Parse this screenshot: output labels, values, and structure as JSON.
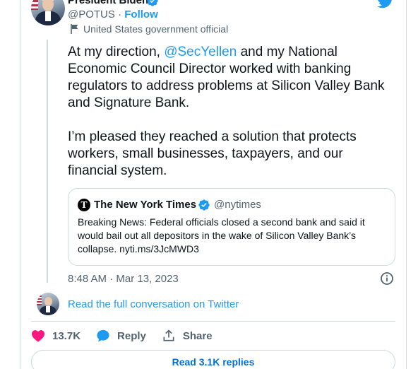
{
  "author": {
    "name": "President Biden",
    "handle": "@POTUS",
    "separator": " · ",
    "follow_label": "Follow",
    "gov_label": "United States government official"
  },
  "tweet": {
    "line1_prefix": "At my direction, ",
    "mention": "@SecYellen",
    "line1_suffix": " and my National Economic Council Director worked with banking regulators to address problems at Silicon Valley Bank and Signature Bank.",
    "paragraph2": "I’m pleased they reached a solution that protects workers, small businesses, taxpayers, and our financial system."
  },
  "quote": {
    "name": "The New York Times",
    "handle": "@nytimes",
    "logo_glyph": "T",
    "text": "Breaking News: Federal officials closed a second bank and said it would bail out all depositors in the wake of Silicon Valley Bank’s collapse. nyti.ms/3JcMWD3"
  },
  "meta": {
    "timestamp": "8:48 AM · Mar 13, 2023"
  },
  "conversation_link": "Read the full conversation on Twitter",
  "actions": {
    "like_count": "13.7K",
    "reply_label": "Reply",
    "share_label": "Share"
  },
  "read_replies_label": "Read 3.1K replies",
  "icons": {
    "verified": "verified-badge-icon",
    "twitter": "twitter-bird-icon",
    "flag": "government-flag-icon",
    "info": "info-icon",
    "heart": "heart-icon",
    "reply": "reply-bubble-icon",
    "share": "share-upload-icon"
  },
  "colors": {
    "accent": "#1d9bf0",
    "like": "#f91880",
    "text": "#0f1419",
    "muted": "#536471",
    "border": "#cfd9de"
  }
}
